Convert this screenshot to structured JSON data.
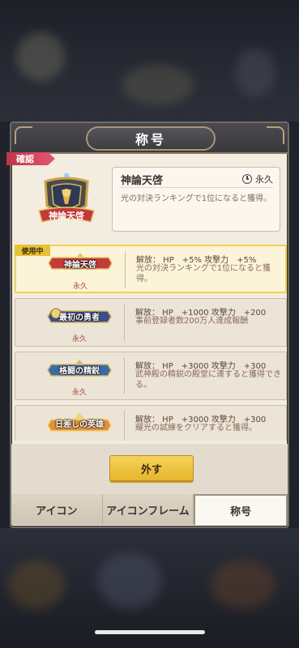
{
  "header": {
    "title": "称号"
  },
  "confirm_tag": "確認",
  "detail": {
    "name": "神論天啓",
    "duration": "永久",
    "description": "光の対決ランキングで1位になると獲得。",
    "badge_text": "神論天啓"
  },
  "titles": [
    {
      "badge": "神論天啓",
      "duration": "永久",
      "stats": "解放： HP　+5%  攻撃力　+5%",
      "description": "光の対決ランキングで1位になると獲得。",
      "in_use": true,
      "in_use_label": "使用中",
      "color": "#c23a3a"
    },
    {
      "badge": "最初の勇者",
      "duration": "永久",
      "stats": "解放： HP　+1000 攻撃力　+200",
      "description": "事前登録者数200万人達成報酬",
      "in_use": false,
      "color": "#3a4f8f"
    },
    {
      "badge": "格闘の精鋭",
      "duration": "永久",
      "stats": "解放： HP　+3000 攻撃力　+300",
      "description": "武神殿の精鋭の殿堂に達すると獲得できる。",
      "in_use": false,
      "color": "#3b6aa8"
    },
    {
      "badge": "日差しの英雄",
      "duration": "",
      "stats": "解放： HP　+3000 攻撃力　+300",
      "description": "耀光の試練をクリアすると獲得。",
      "in_use": false,
      "color": "#d47a2a"
    }
  ],
  "footer": {
    "remove_button": "外す"
  },
  "tabs": [
    {
      "label": "アイコン",
      "selected": false
    },
    {
      "label": "アイコンフレーム",
      "selected": false
    },
    {
      "label": "称号",
      "selected": true
    }
  ],
  "icons": [
    "clock-icon",
    "crest-icon",
    "title-badge-icon"
  ]
}
